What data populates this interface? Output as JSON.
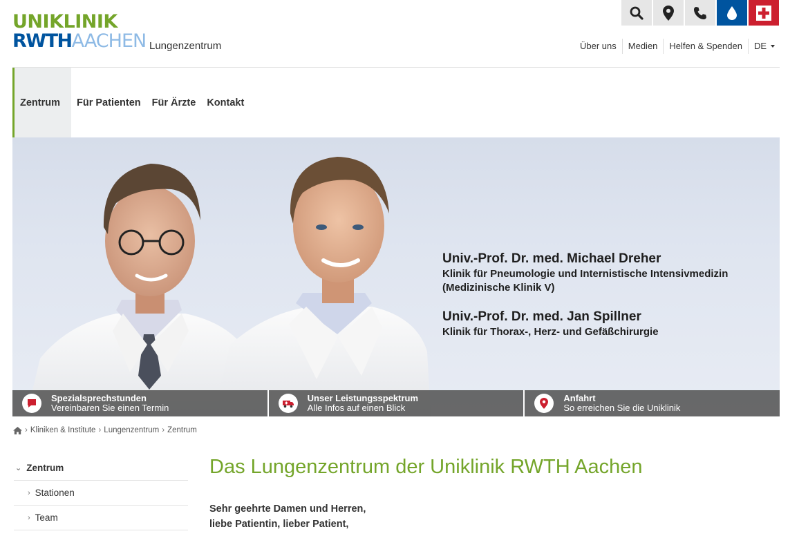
{
  "header": {
    "logo": {
      "line1": "UNIKLINIK",
      "line2_part1": "RWTH",
      "line2_part2": "AACHEN",
      "subtitle": "Lungenzentrum"
    },
    "icons": [
      {
        "name": "search-icon"
      },
      {
        "name": "location-icon"
      },
      {
        "name": "phone-icon"
      },
      {
        "name": "blood-drop-icon",
        "color": "#00549f"
      },
      {
        "name": "emergency-icon",
        "color": "#cc1f2f"
      }
    ],
    "meta_nav": [
      "Über uns",
      "Medien",
      "Helfen & Spenden"
    ],
    "language": "DE"
  },
  "main_nav": {
    "items": [
      "Zentrum",
      "Für Patienten",
      "Für Ärzte",
      "Kontakt"
    ],
    "active": "Zentrum"
  },
  "hero": {
    "doctor1_name": "Univ.-Prof. Dr. med. Michael Dreher",
    "doctor1_dept1": "Klinik für Pneumologie und Internistische Intensivmedizin",
    "doctor1_dept2": "(Medizinische Klinik V)",
    "doctor2_name": "Univ.-Prof. Dr. med. Jan Spillner",
    "doctor2_dept": "Klinik für Thorax-, Herz- und Gefäßchirurgie",
    "teasers": [
      {
        "title": "Spezialsprechstunden",
        "sub": "Vereinbaren Sie einen Termin",
        "icon": "speech-bubble-icon"
      },
      {
        "title": "Unser Leistungsspektrum",
        "sub": "Alle Infos auf einen Blick",
        "icon": "ambulance-icon"
      },
      {
        "title": "Anfahrt",
        "sub": "So erreichen Sie die Uniklinik",
        "icon": "map-pin-icon"
      }
    ]
  },
  "breadcrumb": [
    "Kliniken & Institute",
    "Lungenzentrum",
    "Zentrum"
  ],
  "sidenav": {
    "parent": "Zentrum",
    "children": [
      "Stationen",
      "Team"
    ]
  },
  "content": {
    "title": "Das Lungenzentrum der Uniklinik RWTH Aachen",
    "greeting_line1": "Sehr geehrte Damen und Herren,",
    "greeting_line2": "liebe Patientin, lieber Patient,"
  },
  "colors": {
    "brand_green": "#74a52a",
    "brand_blue": "#00549f",
    "brand_light_blue": "#8ebae5",
    "emergency_red": "#cc1f2f"
  }
}
